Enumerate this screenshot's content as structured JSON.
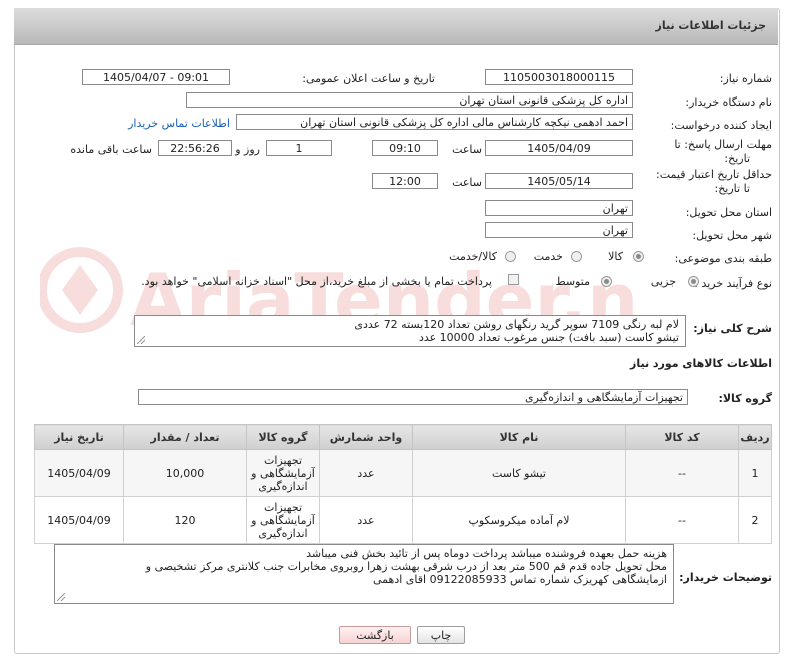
{
  "header": {
    "title": "جزئیات اطلاعات نیاز"
  },
  "fields": {
    "need_number_label": "شماره نیاز:",
    "need_number": "1105003018000115",
    "announce_label": "تاریخ و ساعت اعلان عمومی:",
    "announce_value": "1405/04/07 - 09:01",
    "buyer_label": "نام دستگاه خریدار:",
    "buyer_value": "اداره کل پزشکی قانونی استان تهران",
    "creator_label": "ایجاد کننده درخواست:",
    "creator_value": "احمد ادهمی نیکچه کارشناس مالی اداره کل پزشکی قانونی استان تهران",
    "contact_link": "اطلاعات تماس خریدار",
    "deadline_label_1": "مهلت ارسال پاسخ: تا",
    "deadline_label_2": "تاریخ:",
    "deadline_date": "1405/04/09",
    "time_label": "ساعت",
    "deadline_time": "09:10",
    "days_value": "1",
    "days_label": "روز و",
    "remaining_value": "22:56:26",
    "remaining_label": "ساعت باقی مانده",
    "validity_label_1": "حداقل تاریخ اعتبار قیمت:",
    "validity_label_2": "تا تاریخ:",
    "validity_date": "1405/05/14",
    "validity_time": "12:00",
    "province_label": "استان محل تحویل:",
    "province_value": "تهران",
    "city_label": "شهر محل تحویل:",
    "city_value": "تهران",
    "category_label": "طبقه بندی موضوعی:",
    "category_options": [
      "کالا",
      "خدمت",
      "کالا/خدمت"
    ],
    "process_label": "نوع فرآیند خرید :",
    "process_options": [
      "جزیی",
      "متوسط"
    ],
    "payment_note": "پرداخت تمام یا بخشی از مبلغ خرید،از محل \"اسناد خزانه اسلامی\" خواهد بود."
  },
  "description": {
    "label": "شرح کلی نیاز:",
    "line1": "لام لبه رنگی 7109 سوپر گرید رنگهای روشن تعداد 120بسته 72 عددی",
    "line2": "تیشو کاست (سبد بافت) جنس مرغوب تعداد 10000 عدد"
  },
  "goods_section": {
    "title": "اطلاعات کالاهای مورد نیاز",
    "group_label": "گروه کالا:",
    "group_value": "تجهیزات آزمایشگاهی و اندازه‌گیری"
  },
  "table": {
    "headers": [
      "ردیف",
      "کد کالا",
      "نام کالا",
      "واحد شمارش",
      "گروه کالا",
      "تعداد / مقدار",
      "تاریخ نیاز"
    ],
    "rows": [
      [
        "1",
        "--",
        "تیشو کاست",
        "عدد",
        "تجهیزات آزمایشگاهی و اندازه‌گیری",
        "10,000",
        "1405/04/09"
      ],
      [
        "2",
        "--",
        "لام آماده میکروسکوپ",
        "عدد",
        "تجهیزات آزمایشگاهی و اندازه‌گیری",
        "120",
        "1405/04/09"
      ]
    ]
  },
  "buyer_notes": {
    "label": "توضیحات خریدار:",
    "line1": "هزینه حمل بعهده فروشنده میباشد پرداخت دوماه پس از تائید بخش فنی میباشد",
    "line2": "محل تحویل جاده قدم قم 500 متر بعد از درب شرقی بهشت زهرا روبروی مخابرات جنب کلانتری مرکز تشخیصی و",
    "line3": "ازمایشگاهی کهریزک شماره تماس 09122085933 اقای ادهمی"
  },
  "buttons": {
    "print": "چاپ",
    "back": "بازگشت"
  },
  "watermark": {
    "text": "AriaTender.net"
  }
}
